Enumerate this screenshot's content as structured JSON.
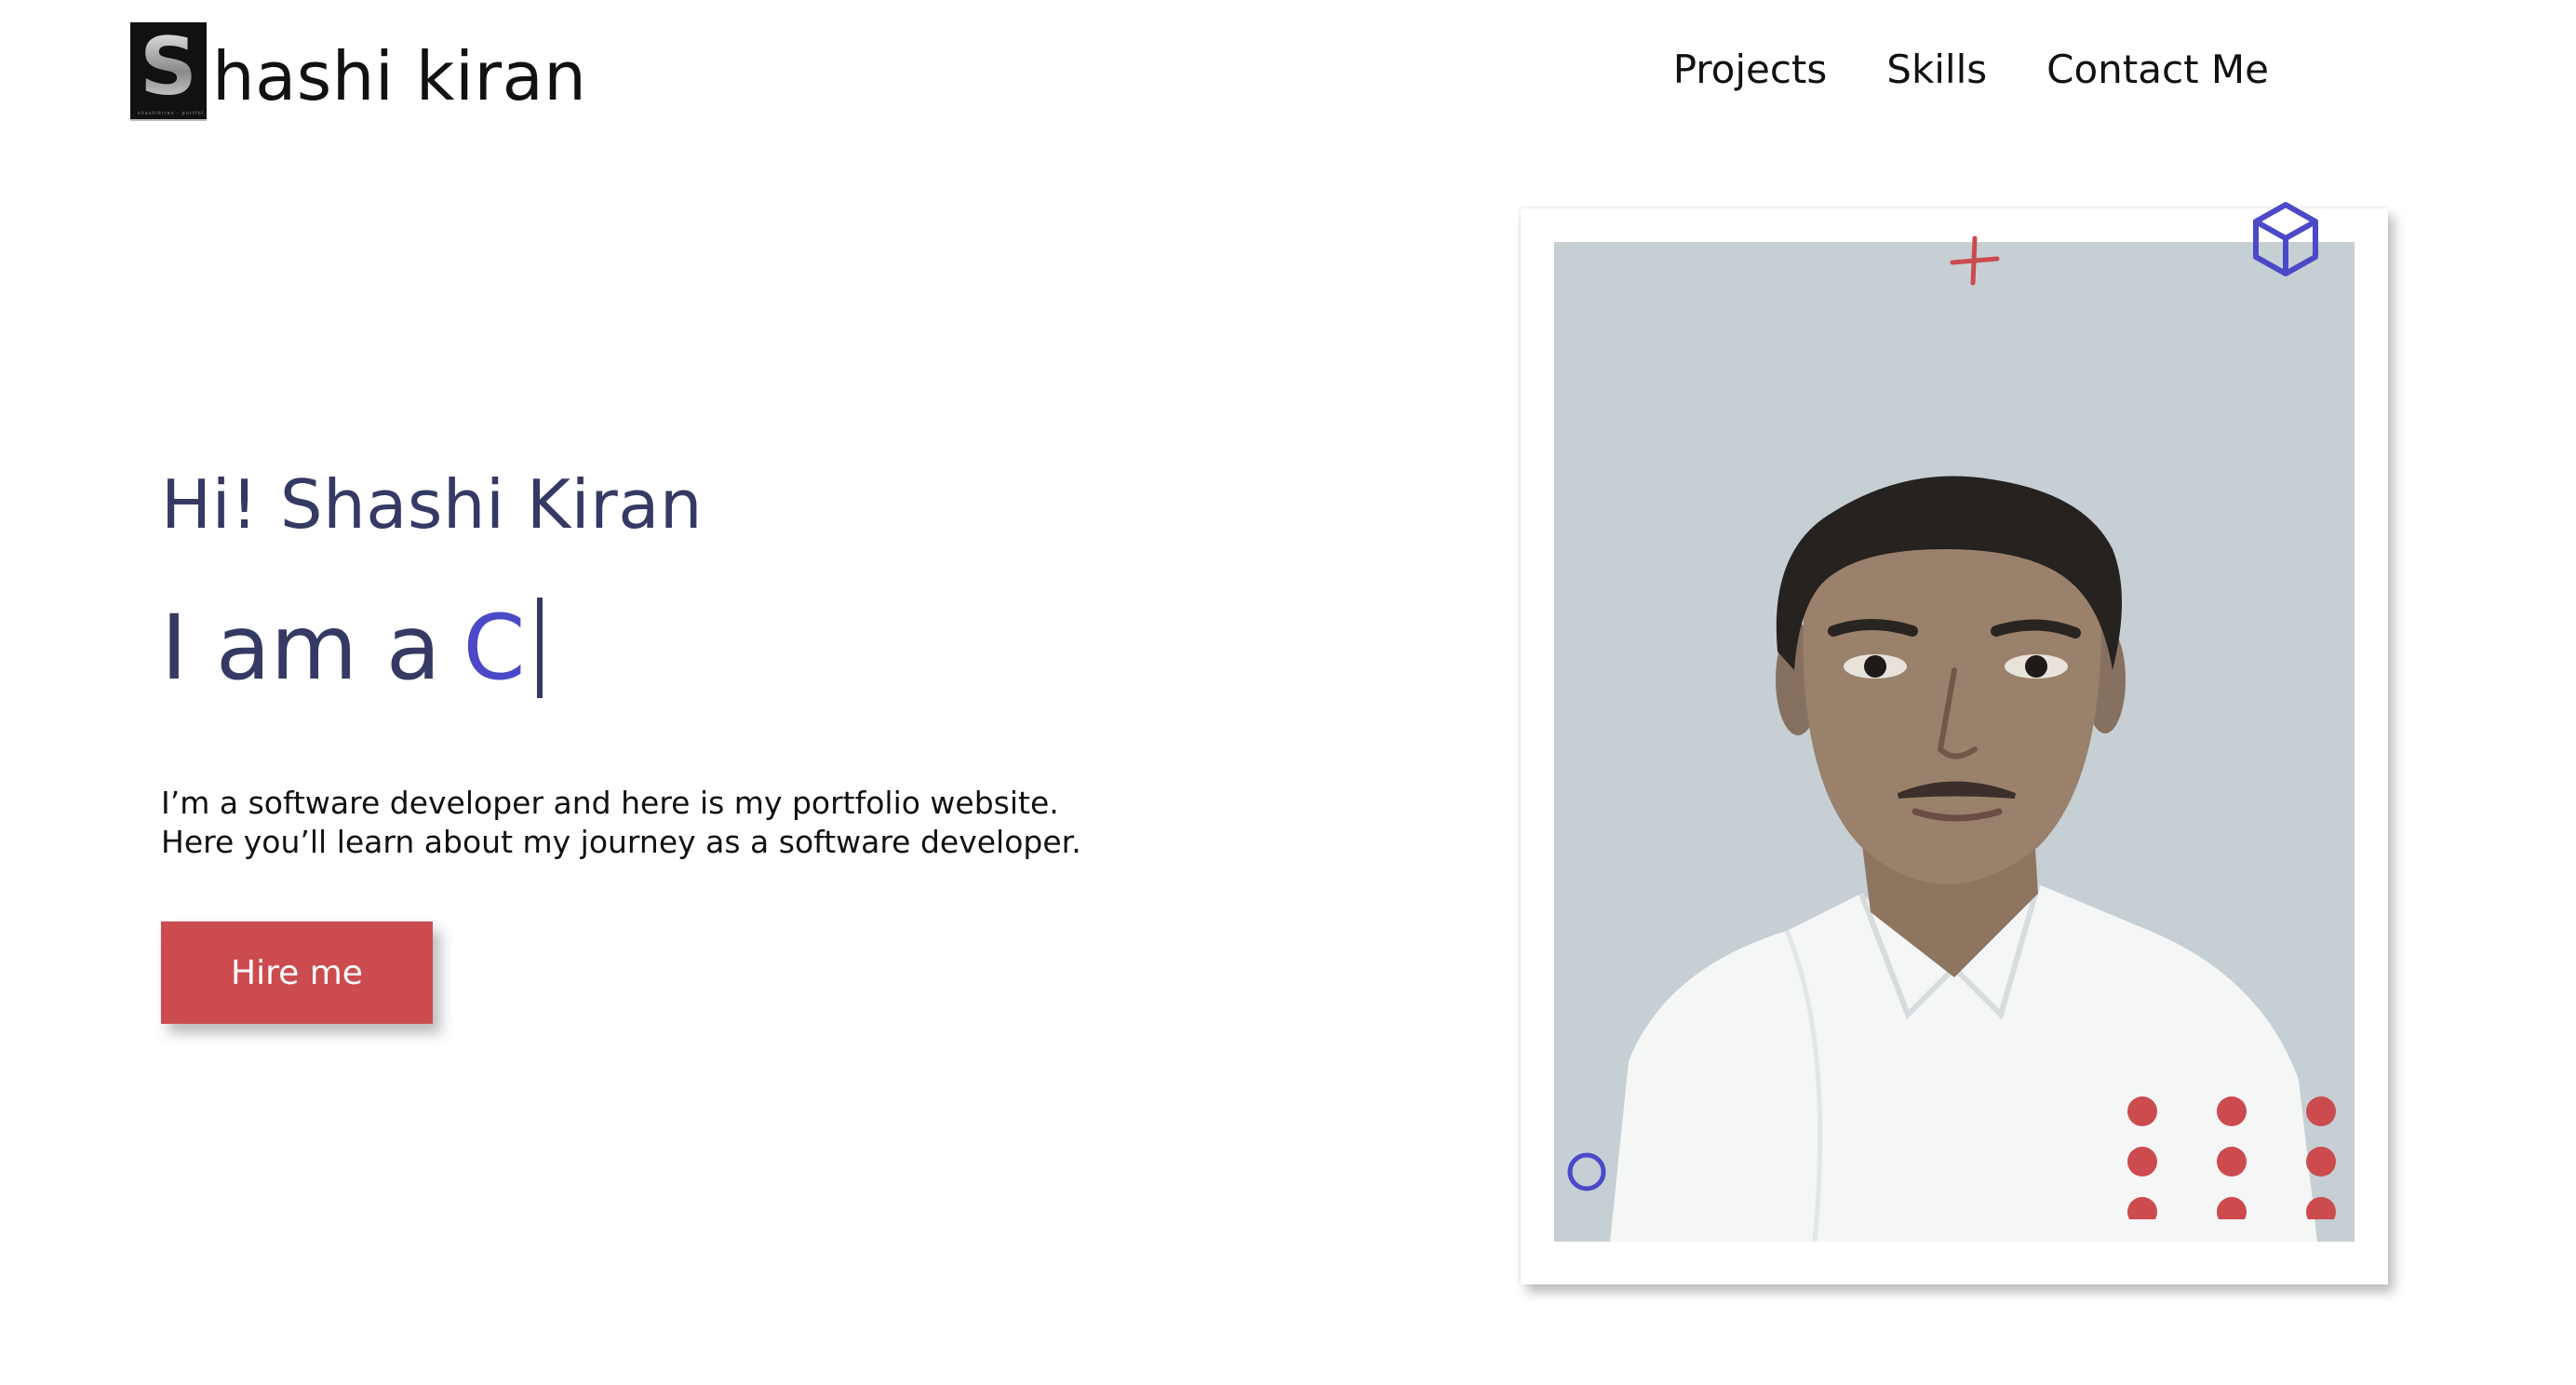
{
  "header": {
    "logo_letter": "S",
    "logo_fineprint": "shashikiran - portfolio",
    "logo_text": "hashi kiran",
    "nav": [
      {
        "label": "Projects"
      },
      {
        "label": "Skills"
      },
      {
        "label": "Contact Me"
      }
    ]
  },
  "hero": {
    "greeting": "Hi! Shashi Kiran",
    "role_prefix": "I am a",
    "role_typed": "C",
    "intro_line1": "I’m a software developer and here is my portfolio website.",
    "intro_line2": "Here you’ll learn about my journey as a software developer.",
    "cta_label": "Hire me"
  },
  "photo": {
    "subject": "portrait-photo",
    "decor_icons": [
      "plus-icon",
      "cube-icon",
      "circle-icon",
      "dot-grid-icon"
    ]
  },
  "colors": {
    "accent_blue": "#4b49c8",
    "heading_navy": "#343a63",
    "cta_red": "#cb4b4f",
    "photo_bg": "#c6cfd3"
  }
}
